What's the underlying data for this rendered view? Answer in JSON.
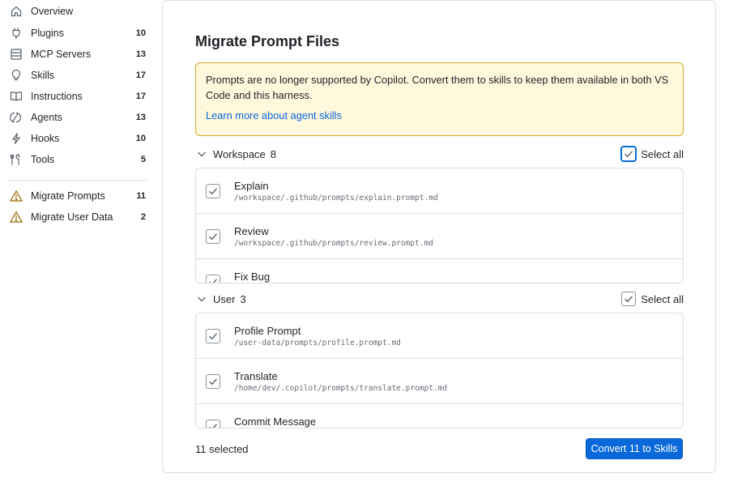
{
  "sidebar": {
    "items": [
      {
        "label": "Overview",
        "count": "",
        "icon": "home-icon"
      },
      {
        "label": "Plugins",
        "count": "10",
        "icon": "plug-icon"
      },
      {
        "label": "MCP Servers",
        "count": "13",
        "icon": "server-icon"
      },
      {
        "label": "Skills",
        "count": "17",
        "icon": "lightbulb-icon"
      },
      {
        "label": "Instructions",
        "count": "17",
        "icon": "book-icon"
      },
      {
        "label": "Agents",
        "count": "13",
        "icon": "agent-icon"
      },
      {
        "label": "Hooks",
        "count": "10",
        "icon": "bolt-icon"
      },
      {
        "label": "Tools",
        "count": "5",
        "icon": "tools-icon"
      }
    ],
    "migrate_items": [
      {
        "label": "Migrate Prompts",
        "count": "11",
        "icon": "warning-icon"
      },
      {
        "label": "Migrate User Data",
        "count": "2",
        "icon": "warning-icon"
      }
    ]
  },
  "main": {
    "title": "Migrate Prompt Files",
    "notice": {
      "text": "Prompts are no longer supported by Copilot. Convert them to skills to keep them available in both VS Code and this harness.",
      "link": "Learn more about agent skills"
    },
    "groups": [
      {
        "name": "Workspace",
        "count": "8",
        "select_all": "Select all",
        "items": [
          {
            "name": "Explain",
            "path": "/workspace/.github/prompts/explain.prompt.md"
          },
          {
            "name": "Review",
            "path": "/workspace/.github/prompts/review.prompt.md"
          },
          {
            "name": "Fix Bug",
            "path": ""
          }
        ]
      },
      {
        "name": "User",
        "count": "3",
        "select_all": "Select all",
        "items": [
          {
            "name": "Profile Prompt",
            "path": "/user-data/prompts/profile.prompt.md"
          },
          {
            "name": "Translate",
            "path": "/home/dev/.copilot/prompts/translate.prompt.md"
          },
          {
            "name": "Commit Message",
            "path": ""
          }
        ]
      }
    ],
    "footer": {
      "selected": "11 selected",
      "convert_label": "Convert 11 to Skills"
    }
  },
  "colors": {
    "accent": "#0969da",
    "notice_bg": "#fff8dc",
    "notice_border": "#d4a72c",
    "warning": "#9a6700"
  }
}
